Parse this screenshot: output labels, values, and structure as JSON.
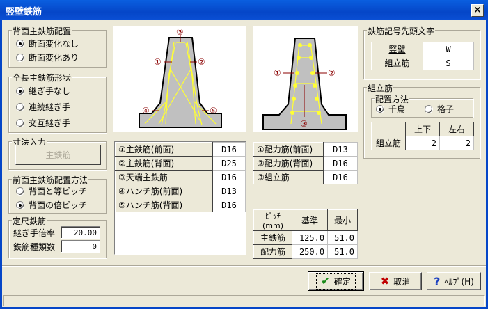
{
  "window": {
    "title": "竪壁鉄筋",
    "close": "×"
  },
  "back_main_layout": {
    "title": "背面主鉄筋配置",
    "options": [
      "断面変化なし",
      "断面変化あり"
    ],
    "selected": 0
  },
  "full_length_shape": {
    "title": "全長主鉄筋形状",
    "options": [
      "継ぎ手なし",
      "連続継ぎ手",
      "交互継ぎ手"
    ],
    "selected": 0
  },
  "dimension_input": {
    "title": "寸法入力",
    "button": "主鉄筋"
  },
  "front_main_layout": {
    "title": "前面主鉄筋配置方法",
    "options": [
      "背面と等ピッチ",
      "背面の倍ピッチ"
    ],
    "selected": 1
  },
  "standard_rebar": {
    "title": "定尺鉄筋",
    "joint_ratio_label": "継ぎ手倍率",
    "joint_ratio": "20.00",
    "types_label": "鉄筋種類数",
    "types": "0"
  },
  "diagram_left": {
    "labels": [
      "①",
      "②",
      "③",
      "④",
      "⑤"
    ]
  },
  "diagram_right": {
    "labels": [
      "①",
      "②",
      "③"
    ]
  },
  "main_rebar_table": [
    {
      "label": "①主鉄筋(前面)",
      "value": "D16"
    },
    {
      "label": "②主鉄筋(背面)",
      "value": "D25"
    },
    {
      "label": "③天端主鉄筋",
      "value": "D16"
    },
    {
      "label": "④ハンチ筋(前面)",
      "value": "D13"
    },
    {
      "label": "⑤ハンチ筋(背面)",
      "value": "D16"
    }
  ],
  "dist_rebar_table": [
    {
      "label": "①配力筋(前面)",
      "value": "D13"
    },
    {
      "label": "②配力筋(背面)",
      "value": "D16"
    },
    {
      "label": "③組立筋",
      "value": "D16"
    }
  ],
  "pitch_table": {
    "headers": [
      "ﾋﾟｯﾁ(mm)",
      "基準",
      "最小"
    ],
    "rows": [
      [
        "主鉄筋",
        "125.0",
        "51.0"
      ],
      [
        "配力筋",
        "250.0",
        "51.0"
      ]
    ]
  },
  "prefix": {
    "title": "鉄筋記号先頭文字",
    "rows": [
      {
        "label": "竪壁",
        "value": "W"
      },
      {
        "label": "組立筋",
        "value": "S"
      }
    ]
  },
  "assembly": {
    "title": "組立筋",
    "method_title": "配置方法",
    "options": [
      "千鳥",
      "格子"
    ],
    "selected": 0,
    "headers": [
      "上下",
      "左右"
    ],
    "row_label": "組立筋",
    "values": [
      "2",
      "2"
    ]
  },
  "buttons": {
    "ok": "確定",
    "cancel": "取消",
    "help": "ﾍﾙﾌﾟ(H)"
  },
  "colors": {
    "title_bar": "#0546c8",
    "rebar": "#ffff33",
    "concrete": "#c0c0c0",
    "arrow": "#8b0000"
  }
}
